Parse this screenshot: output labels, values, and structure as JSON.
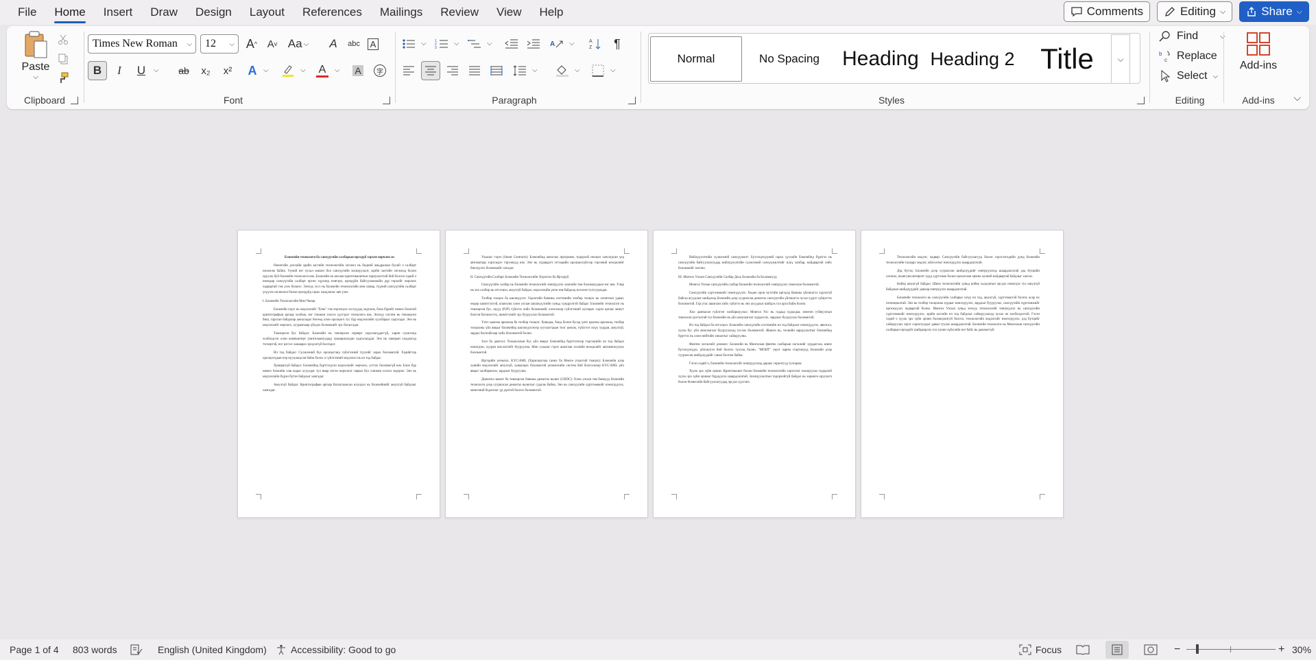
{
  "menu": {
    "tabs": [
      "File",
      "Home",
      "Insert",
      "Draw",
      "Design",
      "Layout",
      "References",
      "Mailings",
      "Review",
      "View",
      "Help"
    ],
    "active_tab": "Home",
    "comments_label": "Comments",
    "editing_label": "Editing",
    "share_label": "Share"
  },
  "ribbon": {
    "clipboard": {
      "paste_label": "Paste",
      "group_label": "Clipboard"
    },
    "font": {
      "font_name": "Times New Roman",
      "font_size": "12",
      "group_label": "Font",
      "bold": "B",
      "italic": "I",
      "underline": "U",
      "strike": "ab",
      "subscript": "x₂",
      "superscript": "x²",
      "grow": "A",
      "shrink": "A",
      "case": "Aa",
      "clear": "A",
      "phonetic": "abc",
      "charborder": "A",
      "effects": "A",
      "highlight": "ab",
      "color": "A",
      "shading": "A",
      "circled": "字",
      "accent_highlight": "#f5e228",
      "accent_font_color": "#e0272a"
    },
    "paragraph": {
      "group_label": "Paragraph"
    },
    "styles": {
      "group_label": "Styles",
      "items": [
        "Normal",
        "No Spacing",
        "Heading",
        "Heading 2",
        "Title"
      ],
      "selected": "Normal"
    },
    "editing": {
      "group_label": "Editing",
      "find_label": "Find",
      "replace_label": "Replace",
      "select_label": "Select"
    },
    "addins": {
      "label": "Add-ins",
      "group_label": "Add-ins"
    }
  },
  "pages": [
    {
      "title": "Блокчейн технологи ба санхүүгийн салбарын ирээдүй хэрхэн өөрчлөх вэ",
      "blocks": [
        {
          "type": "p",
          "text": "Өнөөгийн дэлхийн эдийн засгийн технологийн хөгжил нь бидний амьдралын бүхий л салбарт нөлөөлж байна. Үүний нэг чухал жишээ бол санхүүгийн зохицуулалт, эдийн засгийн хөгжилд болон оруулж буй блокчейн технологи юм. Блокчейн нь анхлан криптовалютын зориулалттай бий болсон хэдий ч өнөөдөр санхүүгийн салбарт өргөн хүрээнд нэвтэрч, ирээдүйн байгууламжийн дүр төрхийг өөрчлөх чадвартай гэж үзэх болжээ. Энэхүү эссэ нь блокчейн технологийн мөн чанар, түүний санхүүгийн салбарт үзүүлэх нөлөөлөл болон ирээдүйд гарах хандлагыг авч үзнэ."
        },
        {
          "type": "h",
          "text": "I. Блокчейн Технологийн Мөн Чанар"
        },
        {
          "type": "p",
          "text": "Блокчейн гэдэг нь мэдээллийг \"блок\" гэж нэрлэгдэх хэсгүүдэд хадгалж, блок бүрийг өмнөх блоктой криптографын аргаар холбож, нэг гинжин хэлхээ үүсгэдэг технологи юм. Энэхүү систем нь төвлөрсөн биш, тархсан байдлаар ажилладаг бөгөөд олон оролцогч тус бүр мэдээллийн хуулбарыг хадгалдаг. Энэ нь мэдээллийг өөрчлөх, хуурамчаар үйлдэх боломжийг эрс багасгадаг."
        },
        {
          "type": "p",
          "text": "Төвлөрсөн бус байдал: Блокчейн нь төвлөрсөн серверт хадгалагддаггүй, харин сүлжээнд холбогдсон олон компьютерт (зангилаануудад) хуваарилагдан хадгалагддаг. Энэ нь хакерын халдлагад тэсвэртэй, нэг цэгээс хамаарах эрсдэлгүй болгодог."
        },
        {
          "type": "p",
          "text": "Ил тод байдал: Сүлжээний бүх оролцогчид гүйлгээний түүхийг харах боломжтой. Хэдийгээр оролцогчдын нэр нууцлагдсан байж болох ч гүйлгээний мэдээлэл нь ил тод байдаг."
        },
        {
          "type": "p",
          "text": "Хувиршгүй байдал: Блокчейнд бүртгэгдсэн мэдээллийг өөрчлөх, устгах боломжгүй юм. Блок бүр өмнөх блокийн хэш кодыг агуулдаг тул ямар нэгэн өөрчлөлт гарвал бүх гинжин хэлхээ эвдэрнэ. Энэ нь мэдээллийн бүрэн бүтэн байдлыг хангадаг."
        },
        {
          "type": "p",
          "text": "Аюулгүй байдал: Криптографын аргаар баталгаажсан нууцлал нь блокчейнийг аюулгүй байдлыг хангадаг."
        }
      ]
    },
    {
      "title": "",
      "blocks": [
        {
          "type": "p",
          "text": "Ухаалаг гэрээ (Smart Contracts): Блокчейнд ажиллах программ, тодорхой нөхцөл хангагдсан үед автоматаар хэрэгждэг гэрээнүүд юм. Энэ нь гуравдагч этгээдийн оролцоогүйгээр гэрээний нөхцөлийг биелүүлэх боломжийг олгодог."
        },
        {
          "type": "h",
          "text": "II. Санхүүгийн Салбарт Блокчейн Технологийн Хэрэглээ ба Ирээдүй"
        },
        {
          "type": "p",
          "text": "Санхүүгийн салбар нь блокчейн технологийг нэвтрүүлэх хамгийн том боломжуудын нэг юм. Учир нь энэ салбар нь итгэлцэл, аюулгүй байдал, мэдээллийн үнэн зөв байдалд ихээхэн тулгуурладаг."
        },
        {
          "type": "p",
          "text": "Төлбөр тооцоо ба шилжүүлэг: Одоогийн банкны системийн төлбөр тооцоо нь олонтоон удаан, өндөр шимтгэлтэй, ялангуяа олон улсын шилжүүлгийн хувьд хүндрэлтэй байдаг. Блокчейн технологи нь төвлөрсөн бус, шууд (P2P) гүйлгээ хийх боломжийг олгосноор гүйлгээний хугацааг хэдэн цагаас минут болгон богиносгох, шимтгэлийг эрс бууруулах боломжтой."
        },
        {
          "type": "p",
          "text": "Үнэт цаасны арилжаа ба төлбөр тооцоо: Хувьцаа, бонд болон бусад үнэт цаасны арилжаа, төлбөр тооцооны үйл явцыг блокчейнд шилжүүлснээр зуучлагчдын тоог цөөлж, гүйлгээг илүү хурдан, аюулгүй, зардал багатайгаар хийх боломжтой болно."
        },
        {
          "type": "p",
          "text": "Зээл ба даатгал: Тооцооллын бүх үйл явцыг блокчейнд бүртгэснээр тэдгээрийн ил тод байдал нэмэгдэж, хууран мэхлэлтийг бууруулна. Мөн ухаалаг гэрээ ашиглан зээлийн нөхцөлийг автоматжуулах боломжтой."
        },
        {
          "type": "p",
          "text": "Иргэдийн үнэмлэх, KYC/AML (Харилцагчаа таних ба Мөнгө угаахтай тэмцэх): Блокчейн дээр хувийн мэдээллийг аюулгүй, хуваалцах боломжтой үнэмлэхийн систем бий болгосноор KYC/AML үйл явцыг хялбарчилж, зардлыг бууруулна."
        },
        {
          "type": "p",
          "text": "Дижитал валют ба төвлөрсөн банкны дижитал валют (CBDC): Олон улсын төв банкууд блокчейн технологи дээр суурилсан дижитал валютыг судалж байна. Энэ нь санхүүгийн хүртээмжийг нэмэгдүүлэх, мөнгөний бодлогыг үр дүнтэй болгох боломжтой."
        }
      ]
    },
    {
      "title": "",
      "blocks": [
        {
          "type": "p",
          "text": "Нийлүүлэлтийн сүлжээний санхүүжилт: Бүтээгдэхүүний гарал үүслийн блокчейнд бүртгэх нь санхүүгийн байгууллагуудад нийлүүлэлтийн сүлжээний санхүүжилтийг илүү хялбар, найдвартай хийх боломжийг олгоно."
        },
        {
          "type": "h",
          "text": "III. Монгол Улсын Санхүүгийн Салбар Дахь Блокчейн ба Боломжууд"
        },
        {
          "type": "p",
          "text": "Монгол Улсын санхүүгийн салбар блокчейн технологийг нэвтрүүлэх томоохон боломжтой."
        },
        {
          "type": "p",
          "text": "Санхүүгийн хүртээмжийг нэмэгдүүлэх: Хөдөө орон нутгийн иргэдэд банкны үйлчилгээ хүрэхгүй байгаа асуудлыг шийдэхэд блокчейн дээр суурилсан дижитал санхүүгийн үйлчилгээ чухал үүрэг гүйцэтгэх боломжтой. Гар утас ашиглан хийх гүйлгээ нь энэ асуудлыг шийдэх гол арга байж болно."
        },
        {
          "type": "p",
          "text": "Хил дамнасан гүйлгээг хялбаршуулах: Монгол Улс нь гадаад худалдаа, мөнгөн гуйвуулгын томоохон урсгалтай тул блокчейн нь үйл ажиллагааг хурдасгах, зардлыг бууруулах боломжтой."
        },
        {
          "type": "p",
          "text": "Ил тод байдал ба итгэлцэл: Блокчейн санхүүгийн системийн ил тод байдлыг нэмэгдүүлэх, авилгал, хууль бус үйл ажиллагааг бууруулахад туслах боломжтой. Жишээ нь, төсвийн зарцуулалтыг блокчейнд бүртгэх нь олон нийтийн хяналтыг сайжруулна."
        },
        {
          "type": "p",
          "text": "Финтек хөгжлийг дэмжих: Блокчейн нь Монголын финтек салбарын хөгжлийг хурдасгаж, шинэ бүтээгдэхүүн, үйлчилгээ бий болгох түлхэц болно. \"МОНТ\" зэрэг зарим стартапууд блокчейн дээр суурилсан шийдлүүдийг санал болгож байна."
        },
        {
          "type": "p",
          "text": "Гэсэн хэдий ч, блокчейн технологийг нэвтрүүлэхэд дараах сорилтууд тулгарна:"
        },
        {
          "type": "p",
          "text": "Хууль эрх зүйн орчин: Криптовалют болон блокчейн технологийн хэрэглээг зохицуулах тодорхой хууль эрх зүйн орчныг бүрдүүлэх шаардлагатай. Зохицуулалтын тодорхойгүй байдал нь хөрөнгө оруулагч болон бизнесийн байгууллагуудад эрсдэл үүсгэнэ."
        }
      ]
    },
    {
      "title": "",
      "blocks": [
        {
          "type": "p",
          "text": "Технологийн мэдлэг, чадвар: Санхүүгийн байгууллагууд болон хэрэглэгчдийн дунд блокчейн технологийн талаарх мэдлэг, ойлголтыг нэмэгдүүлэх шаардлагатай."
        },
        {
          "type": "p",
          "text": "Дэд бүтэц: Блокчейн дээр суурилсан шийдлүүдийг нэвтрүүлэхэд шаардлагатай дэд бүтцийн хөгжил, ялангуяа интернэт хурд хүртээмж болон цахилгаан эрчим хүчний найдвартай байдлыг хангах."
        },
        {
          "type": "p",
          "text": "Кибер аюулгүй байдал: Шинэ технологийн хувьд кибер халдлагын эрсдэл нэмэгдэх тул аюулгүй байдлын шийдлүүдийг давхар нэвтрүүлэх шаардлагатай."
        },
        {
          "type": "p",
          "text": "Блокчейн технологи нь санхүүгийн салбарыг илүү ил тод, аюулгүй, хүртээмжтэй болгох асар их потенциалтай. Энэ нь төлбөр тооцооны хурдыг нэмэгдүүлэх, зардлыг бууруулах, санхүүгийн хүртээмжийг өргөжүүлэх чадвартай болно. Монгол Улсын хувьд энэхүү технологийг нэвтрүүлэх нь санхүүгийн хүртээмжийг нэмэгдүүлэх, эдийн засгийн ил тод байдлыг сайжруулахад чухал ач холбогдолтой. Гэсэн хэдий ч хууль эрх зүйн орчин боловсронгуй болгох, технологийн мэдлэгийг нэмэгдүүлэх, дэд бүтцийг сайжруулах зэрэг сорилтуудыг даван туулах шаардлагатай. Блокчейн технологи нь Монголын санхүүгийн салбарын ирээдүйг шийдвэрлэх гол хүчин зүйлсийн нэг байх нь дамжиггүй."
        }
      ]
    }
  ],
  "status": {
    "page": "Page 1 of 4",
    "words": "803 words",
    "language": "English (United Kingdom)",
    "accessibility": "Accessibility: Good to go",
    "focus": "Focus",
    "zoom": "30%"
  }
}
